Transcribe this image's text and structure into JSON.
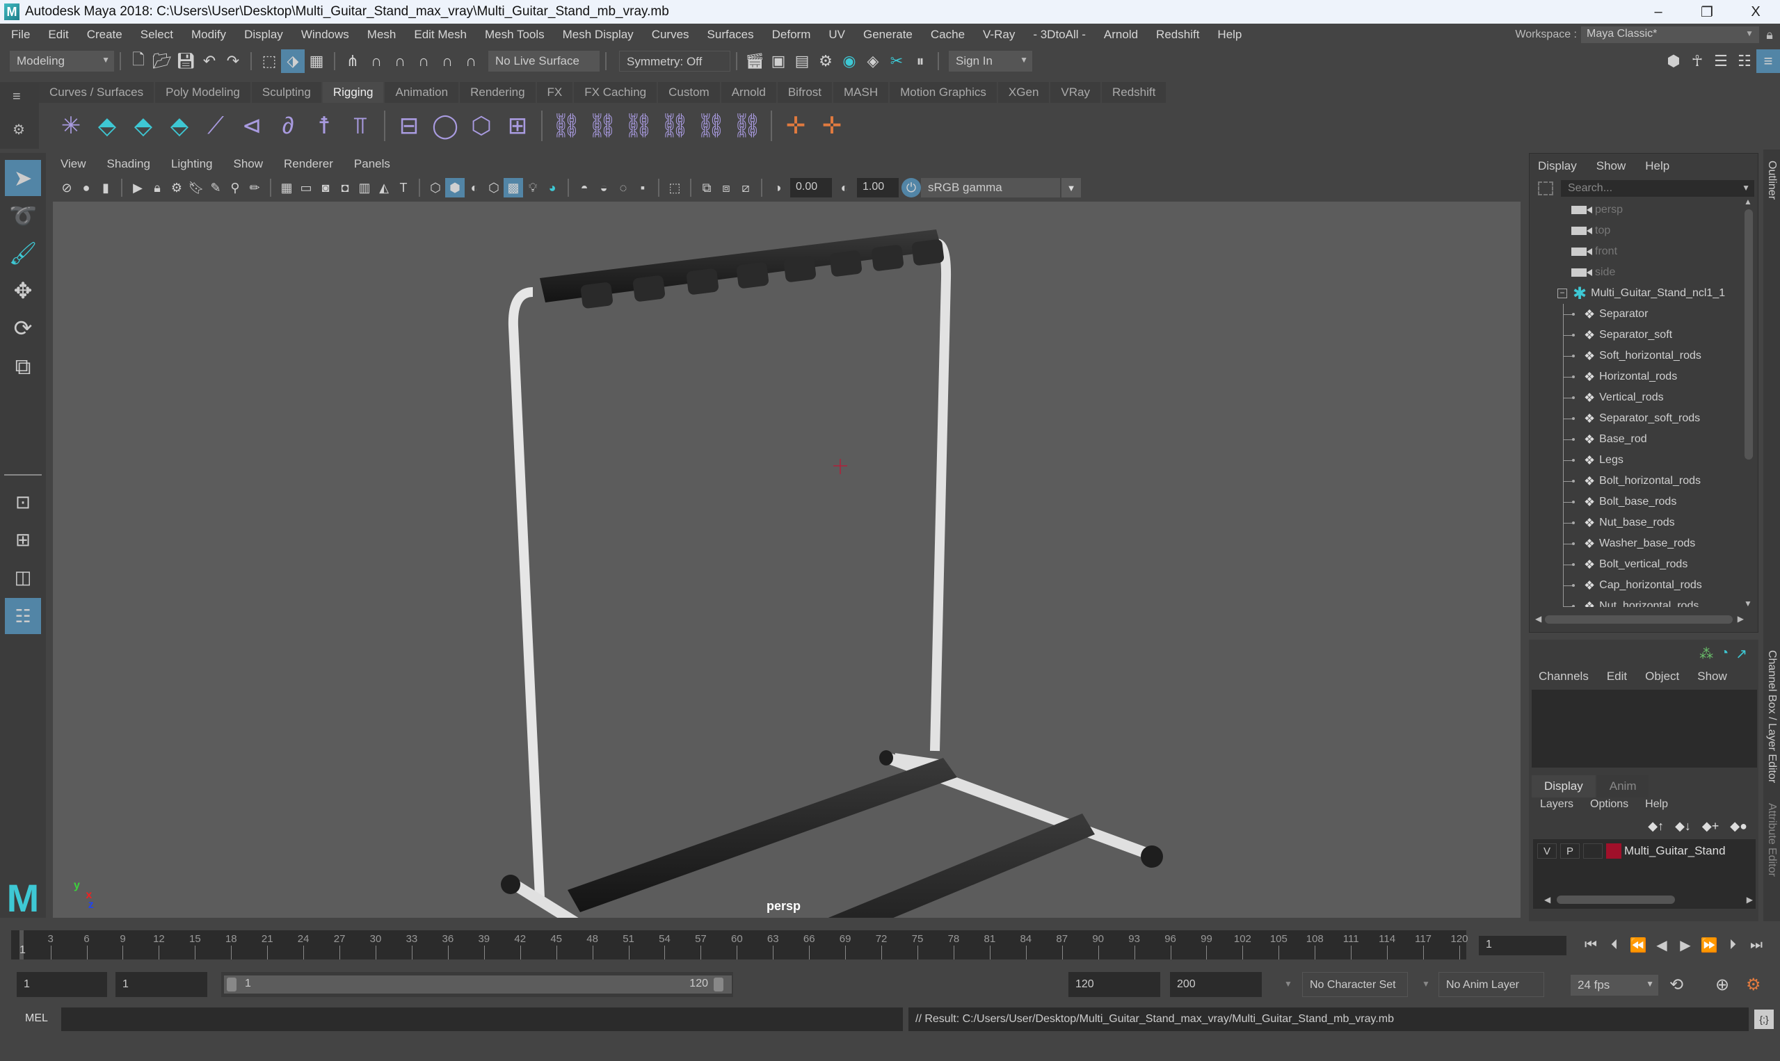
{
  "window": {
    "title": "Autodesk Maya 2018: C:\\Users\\User\\Desktop\\Multi_Guitar_Stand_max_vray\\Multi_Guitar_Stand_mb_vray.mb",
    "controls": [
      "–",
      "❐",
      "X"
    ]
  },
  "menubar": {
    "items": [
      "File",
      "Edit",
      "Create",
      "Select",
      "Modify",
      "Display",
      "Windows",
      "Mesh",
      "Edit Mesh",
      "Mesh Tools",
      "Mesh Display",
      "Curves",
      "Surfaces",
      "Deform",
      "UV",
      "Generate",
      "Cache",
      "V-Ray",
      "- 3DtoAll -",
      "Arnold",
      "Redshift",
      "Help"
    ],
    "workspace_label": "Workspace :",
    "workspace_value": "Maya Classic*"
  },
  "statusline": {
    "mode": "Modeling",
    "live_surface": "No Live Surface",
    "symmetry": "Symmetry: Off",
    "sign_in": "Sign In"
  },
  "shelf": {
    "tabs": [
      "Curves / Surfaces",
      "Poly Modeling",
      "Sculpting",
      "Rigging",
      "Animation",
      "Rendering",
      "FX",
      "FX Caching",
      "Custom",
      "Arnold",
      "Bifrost",
      "MASH",
      "Motion Graphics",
      "XGen",
      "VRay",
      "Redshift"
    ],
    "active_tab": "Rigging"
  },
  "viewport": {
    "menu": [
      "View",
      "Shading",
      "Lighting",
      "Show",
      "Renderer",
      "Panels"
    ],
    "exposure": "0.00",
    "gamma": "1.00",
    "color_space": "sRGB gamma",
    "camera_label": "persp",
    "axis_labels": {
      "y": "y",
      "x": "x",
      "z": "z"
    }
  },
  "outliner": {
    "menu": [
      "Display",
      "Show",
      "Help"
    ],
    "search_placeholder": "Search...",
    "cameras": [
      "persp",
      "top",
      "front",
      "side"
    ],
    "group": "Multi_Guitar_Stand_ncl1_1",
    "children": [
      "Separator",
      "Separator_soft",
      "Soft_horizontal_rods",
      "Horizontal_rods",
      "Vertical_rods",
      "Separator_soft_rods",
      "Base_rod",
      "Legs",
      "Bolt_horizontal_rods",
      "Bolt_base_rods",
      "Nut_base_rods",
      "Washer_base_rods",
      "Bolt_vertical_rods",
      "Cap_horizontal_rods",
      "Nut_horizontal_rods"
    ]
  },
  "channelbox": {
    "menu": [
      "Channels",
      "Edit",
      "Object",
      "Show"
    ],
    "layer_tabs": [
      "Display",
      "Anim"
    ],
    "layer_menu": [
      "Layers",
      "Options",
      "Help"
    ],
    "layer": {
      "v": "V",
      "p": "P",
      "name": "Multi_Guitar_Stand",
      "color": "#a0102a"
    }
  },
  "side_tabs": [
    "Outliner",
    "Channel Box / Layer Editor",
    "Attribute Editor"
  ],
  "timeline": {
    "ticks": [
      "3",
      "6",
      "9",
      "12",
      "15",
      "18",
      "21",
      "24",
      "27",
      "30",
      "33",
      "36",
      "39",
      "42",
      "45",
      "48",
      "51",
      "54",
      "57",
      "60",
      "63",
      "66",
      "69",
      "72",
      "75",
      "78",
      "81",
      "84",
      "87",
      "90",
      "93",
      "96",
      "99",
      "102",
      "105",
      "108",
      "111",
      "114",
      "117",
      "120"
    ],
    "current_frame": "1",
    "current_frame_field": "1"
  },
  "range": {
    "start": "1",
    "playback_start": "1",
    "slider_start": "1",
    "slider_end": "120",
    "playback_end": "120",
    "end": "200",
    "character_set": "No Character Set",
    "anim_layer": "No Anim Layer",
    "fps": "24 fps"
  },
  "command": {
    "language": "MEL",
    "result": "// Result: C:/Users/User/Desktop/Multi_Guitar_Stand_max_vray/Multi_Guitar_Stand_mb_vray.mb"
  },
  "colors": {
    "accent": "#5285a6",
    "teal": "#3ec8d4",
    "key_orange": "#e07a3f"
  }
}
